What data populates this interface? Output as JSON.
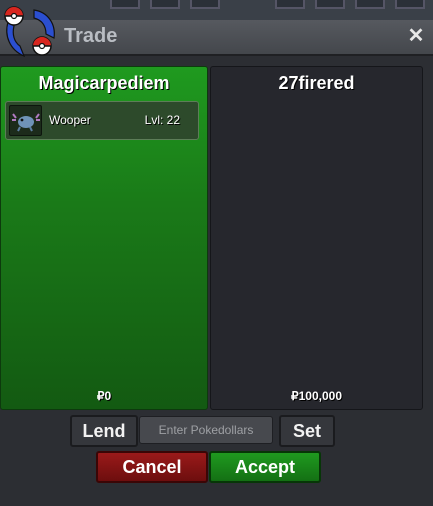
{
  "window": {
    "title": "Trade",
    "close_icon": "✕"
  },
  "left_panel": {
    "player_name": "Magicarpediem",
    "color": "#1a7a18",
    "items": [
      {
        "name": "Wooper",
        "level": "Lvl: 22",
        "icon": "wooper-sprite-icon"
      }
    ],
    "money": "₽0"
  },
  "right_panel": {
    "player_name": "27firered",
    "color": "#26272d",
    "money": "₽100,000"
  },
  "controls": {
    "lend_label": "Lend",
    "pokedollar_placeholder": "Enter Pokedollars",
    "set_label": "Set",
    "cancel_label": "Cancel",
    "accept_label": "Accept"
  }
}
